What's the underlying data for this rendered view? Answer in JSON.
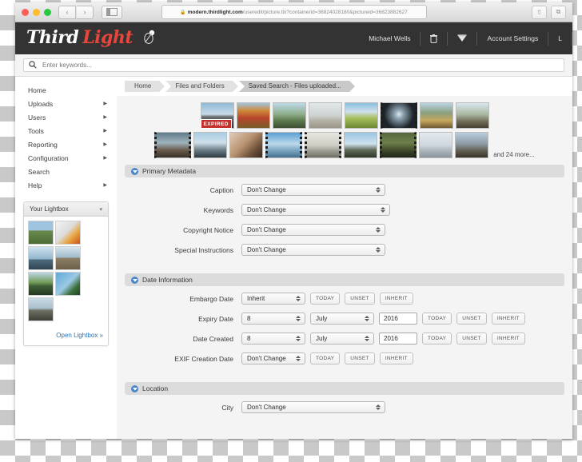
{
  "browser": {
    "url_lock": "ὑ2",
    "url_domain": "modern.thirdlight.com",
    "url_path": "/useredit/picture.tlx?containerid=36824028180&pictureid=36823882627",
    "back_icon": "‹",
    "forward_icon": "›",
    "share_icon": "⇧",
    "tabs_icon": "⧉"
  },
  "header": {
    "logo_first": "Third",
    "logo_second": "Light",
    "user_name": "Michael Wells",
    "trash_icon": "trash-icon",
    "lightbox_icon": "lightbox-icon",
    "account_settings": "Account Settings",
    "logout": "L"
  },
  "search": {
    "placeholder": "Enter keywords...",
    "value": "",
    "icon": "search-icon"
  },
  "sidebar": {
    "items": [
      {
        "label": "Home",
        "arrow": false
      },
      {
        "label": "Uploads",
        "arrow": true
      },
      {
        "label": "Users",
        "arrow": true
      },
      {
        "label": "Tools",
        "arrow": true
      },
      {
        "label": "Reporting",
        "arrow": true
      },
      {
        "label": "Configuration",
        "arrow": true
      },
      {
        "label": "Search",
        "arrow": false
      },
      {
        "label": "Help",
        "arrow": true
      }
    ],
    "lightbox": {
      "title": "Your Lightbox",
      "chevron": "▾",
      "open_link": "Open Lightbox »",
      "thumb_count": 7
    }
  },
  "breadcrumbs": [
    {
      "label": "Home",
      "active": false
    },
    {
      "label": "Files and Folders",
      "active": false
    },
    {
      "label": "Saved Search - Files uploaded...",
      "active": true
    }
  ],
  "strip": {
    "expired_badge": "EXPIRED",
    "more_text": "and 24 more..."
  },
  "sections": {
    "primary": {
      "title": "Primary Metadata",
      "rows": [
        {
          "label": "Caption",
          "value": "Don't Change"
        },
        {
          "label": "Keywords",
          "value": "Don't Change"
        },
        {
          "label": "Copyright Notice",
          "value": "Don't Change"
        },
        {
          "label": "Special Instructions",
          "value": "Don't Change"
        }
      ]
    },
    "dates": {
      "title": "Date Information",
      "buttons": {
        "today": "TODAY",
        "unset": "UNSET",
        "inherit": "INHERIT"
      },
      "rows": [
        {
          "label": "Embargo Date",
          "value": "Inherit",
          "full": false
        },
        {
          "label": "Expiry Date",
          "day": "8",
          "month": "July",
          "year": "2016",
          "full": true
        },
        {
          "label": "Date Created",
          "day": "8",
          "month": "July",
          "year": "2016",
          "full": true
        },
        {
          "label": "EXIF Creation Date",
          "value": "Don't Change",
          "full": false
        }
      ]
    },
    "location": {
      "title": "Location",
      "rows": [
        {
          "label": "City",
          "value": "Don't Change"
        }
      ]
    }
  },
  "colors": {
    "brand_red": "#e8453c",
    "header_bg": "#333333",
    "accent_blue": "#4a86c8",
    "expired_red": "#c4302b",
    "link_blue": "#2b72b8"
  }
}
